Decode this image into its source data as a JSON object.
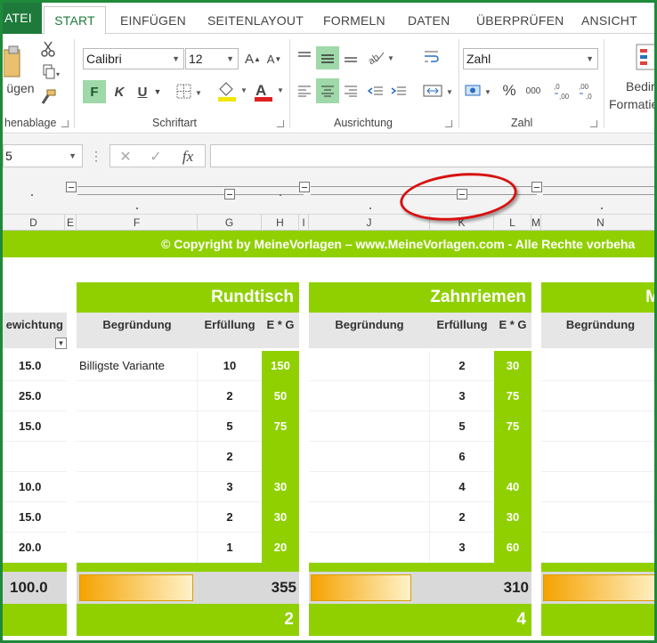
{
  "tabs": [
    "ATEI",
    "START",
    "EINFÜGEN",
    "SEITENLAYOUT",
    "FORMELN",
    "DATEN",
    "ÜBERPRÜFEN",
    "ANSICHT"
  ],
  "ribbon": {
    "clipboard_label": "henablage",
    "paste_label": "ügen",
    "font_label": "Schriftart",
    "alignment_label": "Ausrichtung",
    "number_label": "Zahl",
    "font_name": "Calibri",
    "font_size": "12",
    "number_format": "Zahl",
    "bold": "F",
    "italic": "K",
    "underline": "U",
    "font_color": "#e02020",
    "fill_color": "#f2e600",
    "cond_format_line1": "Bedir",
    "cond_format_line2": "Formatie"
  },
  "formula_bar": {
    "namebox": "5",
    "fx": "fx"
  },
  "columns": [
    "D",
    "E",
    "F",
    "G",
    "H",
    "I",
    "J",
    "K",
    "L",
    "M",
    "N"
  ],
  "sheet": {
    "copyright": "© Copyright by MeineVorlagen – www.MeineVorlagen.com - Alle Rechte vorbeha",
    "weight_header": "ewichtung",
    "weights": [
      "15.0",
      "25.0",
      "15.0",
      "",
      "10.0",
      "15.0",
      "20.0"
    ],
    "weight_sum": "100.0",
    "blocks": [
      {
        "title": "Rundtisch",
        "col_reason": "Begründung",
        "col_fulfil": "Erfüllung",
        "col_eg": "E * G",
        "reasons": [
          "Billigste Variante",
          "",
          "",
          "",
          "",
          "",
          ""
        ],
        "fulfilment": [
          "10",
          "2",
          "5",
          "2",
          "3",
          "2",
          "1"
        ],
        "eg": [
          "150",
          "50",
          "75",
          "",
          "30",
          "30",
          "20"
        ],
        "sum": "355",
        "rank": "2"
      },
      {
        "title": "Zahnriemen",
        "col_reason": "Begründung",
        "col_fulfil": "Erfüllung",
        "col_eg": "E * G",
        "reasons": [
          "",
          "",
          "",
          "",
          "",
          "",
          ""
        ],
        "fulfilment": [
          "2",
          "3",
          "5",
          "6",
          "4",
          "2",
          "3"
        ],
        "eg": [
          "30",
          "75",
          "75",
          "",
          "40",
          "30",
          "60"
        ],
        "sum": "310",
        "rank": "4"
      },
      {
        "title": "M",
        "col_reason": "Begründung"
      }
    ]
  }
}
